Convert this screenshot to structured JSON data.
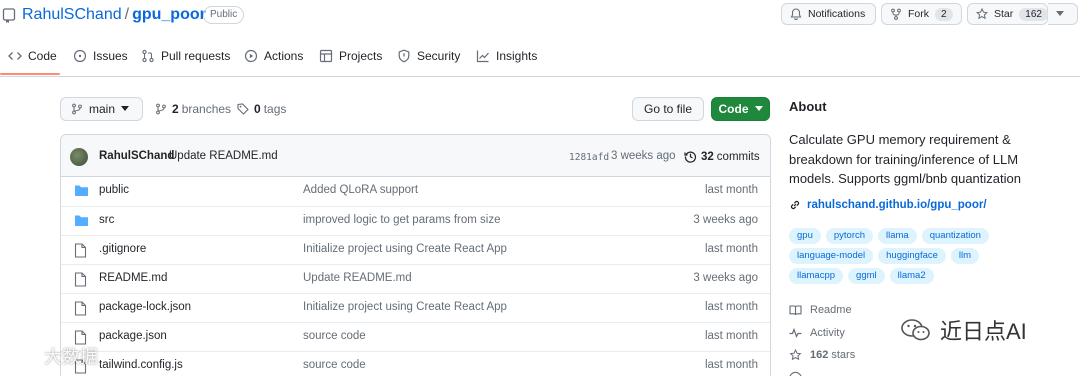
{
  "repo": {
    "owner": "RahulSChand",
    "separator": "/",
    "name": "gpu_poor",
    "visibility": "Public"
  },
  "header_actions": {
    "notifications": "Notifications",
    "fork_label": "Fork",
    "fork_count": "2",
    "star_label": "Star",
    "star_count": "162"
  },
  "tabs": [
    {
      "label": "Code",
      "icon": "code-icon",
      "active": true
    },
    {
      "label": "Issues",
      "icon": "issue-icon"
    },
    {
      "label": "Pull requests",
      "icon": "pull-request-icon"
    },
    {
      "label": "Actions",
      "icon": "play-icon"
    },
    {
      "label": "Projects",
      "icon": "table-icon"
    },
    {
      "label": "Security",
      "icon": "shield-icon"
    },
    {
      "label": "Insights",
      "icon": "graph-icon"
    }
  ],
  "branch_bar": {
    "branch": "main",
    "branches_count": "2",
    "branches_label": "branches",
    "tags_count": "0",
    "tags_label": "tags",
    "go_to_file": "Go to file",
    "code_button": "Code"
  },
  "latest_commit": {
    "author": "RahulSChand",
    "message": "Update README.md",
    "hash": "1281afd",
    "time": "3 weeks ago",
    "commits_count": "32",
    "commits_label": "commits"
  },
  "files": [
    {
      "type": "dir",
      "name": "public",
      "message": "Added QLoRA support",
      "time": "last month"
    },
    {
      "type": "dir",
      "name": "src",
      "message": "improved logic to get params from size",
      "time": "3 weeks ago"
    },
    {
      "type": "file",
      "name": ".gitignore",
      "message": "Initialize project using Create React App",
      "time": "last month"
    },
    {
      "type": "file",
      "name": "README.md",
      "message": "Update README.md",
      "time": "3 weeks ago"
    },
    {
      "type": "file",
      "name": "package-lock.json",
      "message": "Initialize project using Create React App",
      "time": "last month"
    },
    {
      "type": "file",
      "name": "package.json",
      "message": "source code",
      "time": "last month"
    },
    {
      "type": "file",
      "name": "tailwind.config.js",
      "message": "source code",
      "time": "last month"
    }
  ],
  "about": {
    "title": "About",
    "description": "Calculate GPU memory requirement & breakdown for training/inference of LLM models. Supports ggml/bnb quantization",
    "link": "rahulschand.github.io/gpu_poor/",
    "topics": [
      "gpu",
      "pytorch",
      "llama",
      "quantization",
      "language-model",
      "huggingface",
      "llm",
      "llamacpp",
      "ggml",
      "llama2"
    ],
    "readme_label": "Readme",
    "activity_label": "Activity",
    "stars_count": "162",
    "stars_label": "stars"
  },
  "watermarks": {
    "left": "大数据",
    "right": "近日点AI"
  },
  "colors": {
    "accent_blue": "#0969da",
    "code_button_green": "#1f883d",
    "active_tab_underline": "#fd8c73",
    "topic_bg": "#ddf4ff",
    "dir_icon": "#54aeff"
  }
}
